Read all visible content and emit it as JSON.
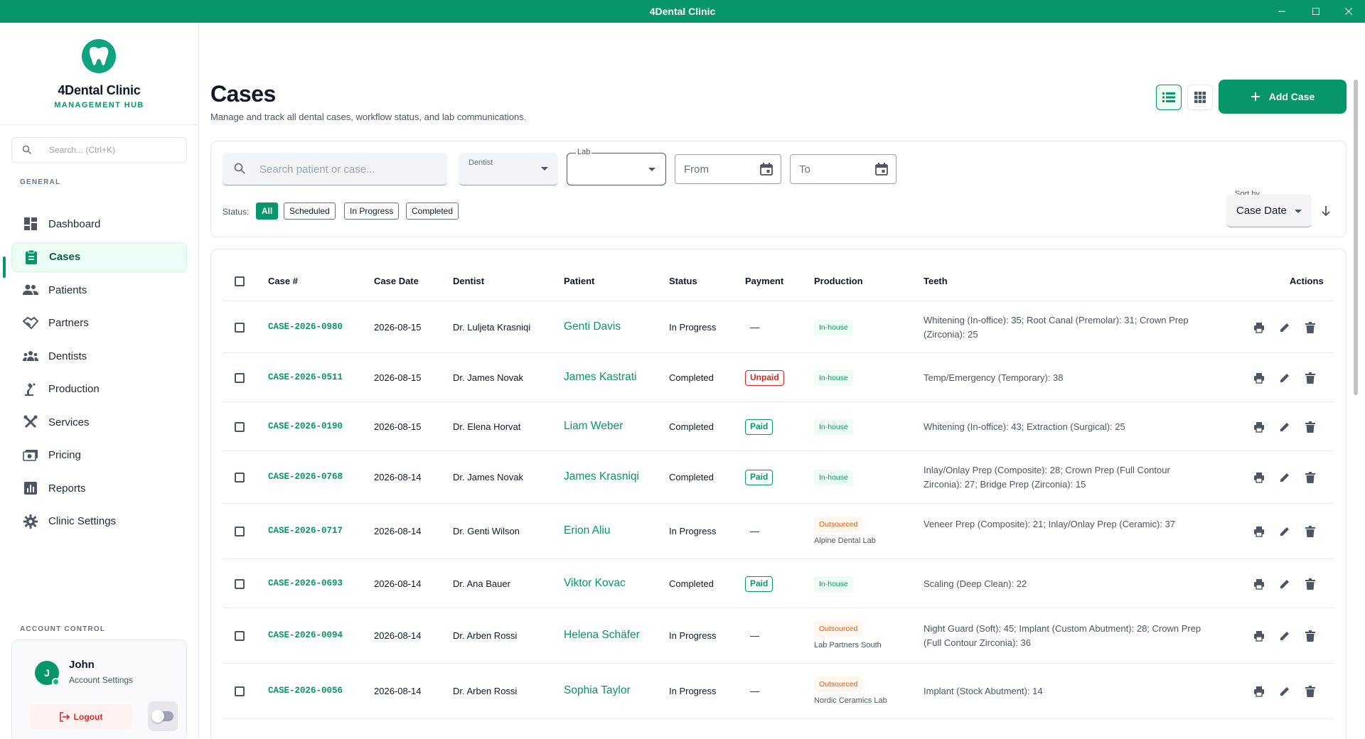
{
  "window": {
    "title": "4Dental Clinic"
  },
  "brand": {
    "name": "4Dental Clinic",
    "subtitle": "MANAGEMENT HUB"
  },
  "sidebar": {
    "search_placeholder": "Search... (Ctrl+K)",
    "section_label": "GENERAL",
    "items": [
      {
        "label": "Dashboard",
        "icon": "dashboard-icon"
      },
      {
        "label": "Cases",
        "icon": "cases-icon"
      },
      {
        "label": "Patients",
        "icon": "patients-icon"
      },
      {
        "label": "Partners",
        "icon": "partners-icon"
      },
      {
        "label": "Dentists",
        "icon": "dentists-icon"
      },
      {
        "label": "Production",
        "icon": "production-icon"
      },
      {
        "label": "Services",
        "icon": "services-icon"
      },
      {
        "label": "Pricing",
        "icon": "pricing-icon"
      },
      {
        "label": "Reports",
        "icon": "reports-icon"
      },
      {
        "label": "Clinic Settings",
        "icon": "settings-icon"
      }
    ],
    "active": "Cases",
    "account_label": "ACCOUNT CONTROL",
    "account": {
      "initial": "J",
      "name": "John",
      "settings": "Account Settings",
      "logout": "Logout"
    }
  },
  "page": {
    "title": "Cases",
    "subtitle": "Manage and track all dental cases, workflow status, and lab communications.",
    "add_button": "Add Case"
  },
  "filters": {
    "search_placeholder": "Search patient or case...",
    "dentist_label": "Dentist",
    "lab_label": "Lab",
    "from_placeholder": "From",
    "to_placeholder": "To",
    "status_label": "Status:",
    "status_chips": [
      "All",
      "Scheduled",
      "In Progress",
      "Completed"
    ],
    "active_status": "All",
    "sort_label": "Sort by",
    "sort_value": "Case Date"
  },
  "table": {
    "headers": {
      "case": "Case #",
      "date": "Case Date",
      "dentist": "Dentist",
      "patient": "Patient",
      "status": "Status",
      "payment": "Payment",
      "production": "Production",
      "teeth": "Teeth",
      "actions": "Actions"
    },
    "rows": [
      {
        "case": "CASE-2026-0980",
        "date": "2026-08-15",
        "dentist": "Dr. Luljeta Krasniqi",
        "patient": "Genti Davis",
        "status": "In Progress",
        "payment": "—",
        "production": "In-house",
        "lab": "",
        "teeth": "Whitening (In-office): 35; Root Canal (Premolar): 31; Crown Prep (Zirconia): 25"
      },
      {
        "case": "CASE-2026-0511",
        "date": "2026-08-15",
        "dentist": "Dr. James Novak",
        "patient": "James Kastrati",
        "status": "Completed",
        "payment": "Unpaid",
        "production": "In-house",
        "lab": "",
        "teeth": "Temp/Emergency (Temporary): 38"
      },
      {
        "case": "CASE-2026-0190",
        "date": "2026-08-15",
        "dentist": "Dr. Elena Horvat",
        "patient": "Liam Weber",
        "status": "Completed",
        "payment": "Paid",
        "production": "In-house",
        "lab": "",
        "teeth": "Whitening (In-office): 43; Extraction (Surgical): 25"
      },
      {
        "case": "CASE-2026-0768",
        "date": "2026-08-14",
        "dentist": "Dr. James Novak",
        "patient": "James Krasniqi",
        "status": "Completed",
        "payment": "Paid",
        "production": "In-house",
        "lab": "",
        "teeth": "Inlay/Onlay Prep (Composite): 28; Crown Prep (Full Contour Zirconia): 27; Bridge Prep (Zirconia): 15"
      },
      {
        "case": "CASE-2026-0717",
        "date": "2026-08-14",
        "dentist": "Dr. Genti Wilson",
        "patient": "Erion Aliu",
        "status": "In Progress",
        "payment": "—",
        "production": "Outsourced",
        "lab": "Alpine Dental Lab",
        "teeth": "Veneer Prep (Composite): 21; Inlay/Onlay Prep (Ceramic): 37"
      },
      {
        "case": "CASE-2026-0693",
        "date": "2026-08-14",
        "dentist": "Dr. Ana Bauer",
        "patient": "Viktor Kovac",
        "status": "Completed",
        "payment": "Paid",
        "production": "In-house",
        "lab": "",
        "teeth": "Scaling (Deep Clean): 22"
      },
      {
        "case": "CASE-2026-0094",
        "date": "2026-08-14",
        "dentist": "Dr. Arben Rossi",
        "patient": "Helena Schäfer",
        "status": "In Progress",
        "payment": "—",
        "production": "Outsourced",
        "lab": "Lab Partners South",
        "teeth": "Night Guard (Soft): 45; Implant (Custom Abutment): 28; Crown Prep (Full Contour Zirconia): 36"
      },
      {
        "case": "CASE-2026-0056",
        "date": "2026-08-14",
        "dentist": "Dr. Arben Rossi",
        "patient": "Sophia Taylor",
        "status": "In Progress",
        "payment": "—",
        "production": "Outsourced",
        "lab": "Nordic Ceramics Lab",
        "teeth": "Implant (Stock Abutment): 14"
      }
    ]
  },
  "colors": {
    "brand": "#079669",
    "danger": "#dc2626",
    "outsourced": "#ea580c"
  }
}
